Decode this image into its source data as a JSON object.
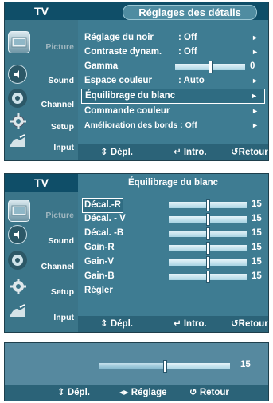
{
  "panel1": {
    "tv_tab": "TV",
    "title": "Réglages des détails",
    "sidebar": [
      {
        "label": "Picture",
        "icon": "picture-icon",
        "active": true
      },
      {
        "label": "Sound",
        "icon": "sound-icon"
      },
      {
        "label": "Channel",
        "icon": "channel-icon"
      },
      {
        "label": "Setup",
        "icon": "setup-icon"
      },
      {
        "label": "Input",
        "icon": "input-icon"
      }
    ],
    "rows": [
      {
        "label": "Réglage du noir",
        "value": ": Off",
        "arrow": "►"
      },
      {
        "label": "Contraste dynam.",
        "value": ": Off",
        "arrow": "►"
      },
      {
        "label": "Gamma",
        "value": "0",
        "slider_fraction": 0.5
      },
      {
        "label": "Espace couleur",
        "value": ": Auto",
        "arrow": "►"
      },
      {
        "label": "Équilibrage du blanc",
        "value": "",
        "arrow": "►",
        "selected": true
      },
      {
        "label": "Commande couleur",
        "value": "",
        "arrow": "►"
      },
      {
        "label": "Amélioration des bords : Off",
        "value": "",
        "arrow": "►"
      }
    ],
    "footer": {
      "move": "Dépl.",
      "enter": "Intro.",
      "back": "Retour"
    }
  },
  "panel2": {
    "tv_tab": "TV",
    "title": "Équilibrage du blanc",
    "sidebar": [
      {
        "label": "Picture",
        "icon": "picture-icon",
        "active": true
      },
      {
        "label": "Sound",
        "icon": "sound-icon"
      },
      {
        "label": "Channel",
        "icon": "channel-icon"
      },
      {
        "label": "Setup",
        "icon": "setup-icon"
      },
      {
        "label": "Input",
        "icon": "input-icon"
      }
    ],
    "rows": [
      {
        "label": "Décal.-R",
        "value": "15",
        "slider_fraction": 0.5,
        "selected": true
      },
      {
        "label": "Décal. - V",
        "value": "15",
        "slider_fraction": 0.5
      },
      {
        "label": "Décal. -B",
        "value": "15",
        "slider_fraction": 0.5
      },
      {
        "label": "Gain-R",
        "value": "15",
        "slider_fraction": 0.5
      },
      {
        "label": "Gain-V",
        "value": "15",
        "slider_fraction": 0.5
      },
      {
        "label": "Gain-B",
        "value": "15",
        "slider_fraction": 0.5
      },
      {
        "label": "Régler",
        "value": ""
      }
    ],
    "footer": {
      "move": "Dépl.",
      "enter": "Intro.",
      "back": "Retour"
    }
  },
  "panel3": {
    "slider_value": "15",
    "slider_fraction": 0.5,
    "footer": {
      "move": "Dépl.",
      "adjust": "Réglage",
      "back": "Retour"
    }
  },
  "colors": {
    "panel_bg": "#3e7c92",
    "title_bar": "#0f4e68",
    "footer_bg": "#2b6378",
    "slider": "#a9d4e3"
  }
}
